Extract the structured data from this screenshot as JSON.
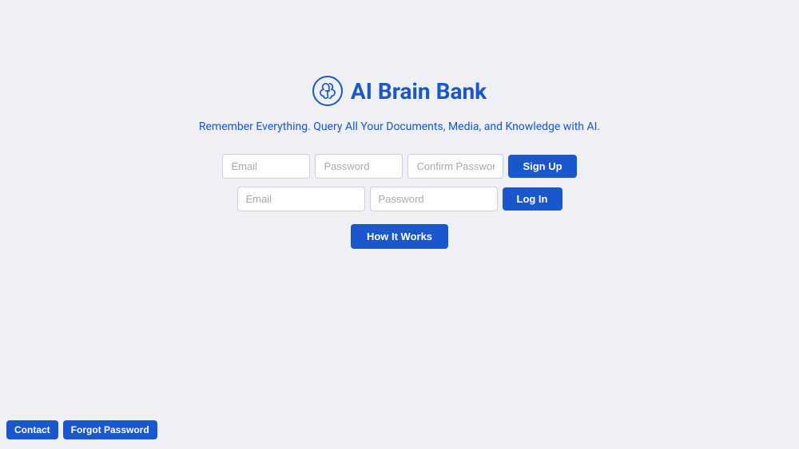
{
  "app": {
    "title": "AI Brain Bank",
    "tagline": "Remember Everything. Query All Your Documents, Media, and Knowledge with AI."
  },
  "signup": {
    "email_placeholder": "Email",
    "password_placeholder": "Password",
    "confirm_placeholder": "Confirm Password",
    "button_label": "Sign Up"
  },
  "login": {
    "email_placeholder": "Email",
    "password_placeholder": "Password",
    "button_label": "Log In"
  },
  "how_it_works": {
    "button_label": "How It Works"
  },
  "footer": {
    "contact_label": "Contact",
    "forgot_label": "Forgot Password"
  },
  "icons": {
    "brain": "🧠"
  }
}
